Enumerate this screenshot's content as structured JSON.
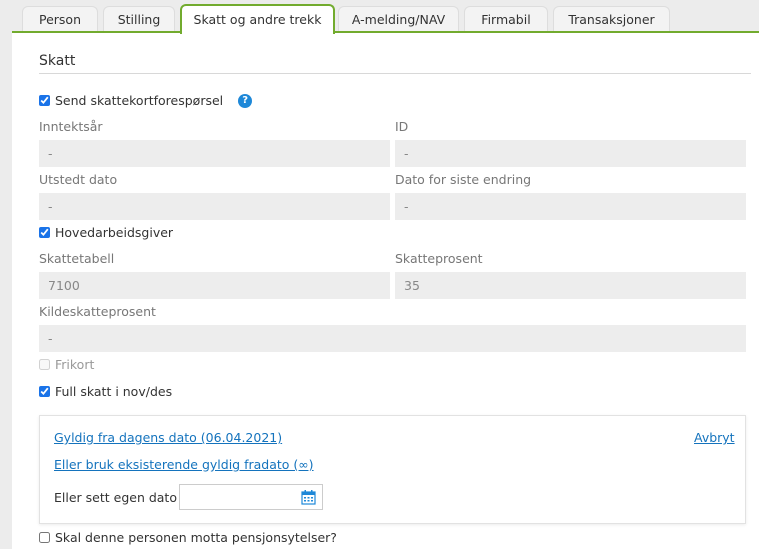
{
  "tabs": [
    {
      "label": "Person"
    },
    {
      "label": "Stilling"
    },
    {
      "label": "Skatt og andre trekk",
      "active": true
    },
    {
      "label": "A-melding/NAV"
    },
    {
      "label": "Firmabil"
    },
    {
      "label": "Transaksjoner"
    }
  ],
  "section_title": "Skatt",
  "send_request": {
    "label": "Send skattekortforespørsel",
    "checked": true,
    "help": "?"
  },
  "fields": {
    "inntektsar": {
      "label": "Inntektsår",
      "value": "-"
    },
    "id": {
      "label": "ID",
      "value": "-"
    },
    "utstedt": {
      "label": "Utstedt dato",
      "value": "-"
    },
    "siste_endring": {
      "label": "Dato for siste endring",
      "value": "-"
    },
    "skattetabell": {
      "label": "Skattetabell",
      "value": "7100"
    },
    "skatteprosent": {
      "label": "Skatteprosent",
      "value": "35"
    },
    "kildeskatt": {
      "label": "Kildeskatteprosent",
      "value": "-"
    }
  },
  "hovedarbeidsgiver": {
    "label": "Hovedarbeidsgiver",
    "checked": true
  },
  "frikort": {
    "label": "Frikort",
    "checked": false
  },
  "full_skatt": {
    "label": "Full skatt i nov/des",
    "checked": true
  },
  "popup": {
    "valid_from_today": "Gyldig fra dagens dato (06.04.2021)",
    "cancel": "Avbryt",
    "use_existing": "Eller bruk eksisterende gyldig fradato (∞)",
    "own_date_label": "Eller sett egen dato",
    "own_date_value": ""
  },
  "pension": {
    "label": "Skal denne personen motta pensjonsytelser?",
    "checked": false
  },
  "colors": {
    "accent": "#72ab2e",
    "link": "#1473bd"
  }
}
